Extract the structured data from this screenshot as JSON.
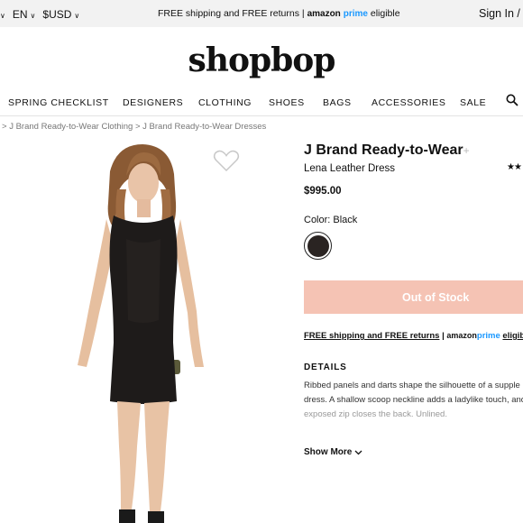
{
  "topbar": {
    "language": "EN",
    "currency": "$USD",
    "promo_text": "FREE shipping and FREE returns |",
    "amazon": "amazon",
    "prime": "prime",
    "eligible": "eligible",
    "signin": "Sign In / R"
  },
  "logo": "shopbop",
  "nav": {
    "items": [
      "SPRING CHECKLIST",
      "DESIGNERS",
      "CLOTHING",
      "SHOES",
      "BAGS",
      "ACCESSORIES",
      "SALE"
    ]
  },
  "breadcrumb": {
    "sep1": ">",
    "crumb1": "J Brand Ready-to-Wear Clothing",
    "sep2": ">",
    "crumb2": "J Brand Ready-to-Wear Dresses"
  },
  "product": {
    "brand": "J Brand Ready-to-Wear",
    "plus": "+",
    "name": "Lena Leather Dress",
    "rating_stars": "★★",
    "price": "$995.00",
    "color_label": "Color: Black",
    "swatch_color": "#2a2422",
    "stock_button": "Out of Stock",
    "shipping": {
      "free_shipping": "FREE shipping and FREE returns",
      "sep": "|",
      "amazon": "amazon",
      "prime": "prime",
      "eligible": "eligible"
    },
    "details_heading": "DETAILS",
    "details_line1": "Ribbed panels and darts shape the silhouette of a supple l",
    "details_line2": "dress. A shallow scoop neckline adds a ladylike touch, and",
    "details_line3": "exposed zip closes the back. Unlined.",
    "show_more": "Show More"
  },
  "colors": {
    "promo_blue": "#1a98ff",
    "oos_pink": "#f5c3b4"
  }
}
